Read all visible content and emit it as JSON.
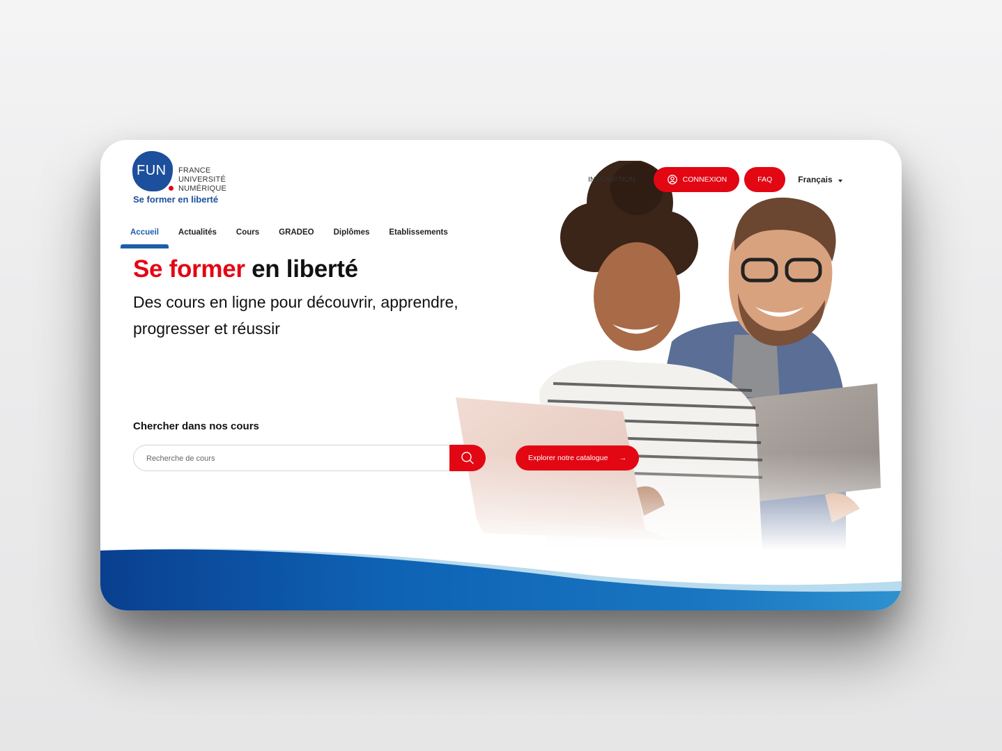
{
  "logo": {
    "mark": "FUN",
    "line1": "FRANCE",
    "line2": "UNIVERSITÉ",
    "line3": "NUMÉRIQUE",
    "tagline": "Se former en liberté"
  },
  "topbar": {
    "inscription": "INSCRIPTION",
    "connexion": "CONNEXION",
    "faq": "FAQ",
    "language": "Français"
  },
  "nav": {
    "items": [
      {
        "label": "Accueil",
        "active": true
      },
      {
        "label": "Actualités"
      },
      {
        "label": "Cours"
      },
      {
        "label": "GRADEO"
      },
      {
        "label": "Diplômes"
      },
      {
        "label": "Etablissements"
      }
    ]
  },
  "hero": {
    "title_red": "Se former",
    "title_black": " en liberté",
    "subtitle": "Des cours en ligne pour découvrir, apprendre, progresser et réussir"
  },
  "search": {
    "label": "Chercher dans nos cours",
    "placeholder": "Recherche de cours",
    "icon": "search-icon"
  },
  "explore": {
    "label": "Explorer notre catalogue",
    "arrow": "→"
  },
  "colors": {
    "brand_red": "#e30613",
    "brand_blue": "#1c4f9c",
    "nav_active": "#1c5fa8"
  }
}
